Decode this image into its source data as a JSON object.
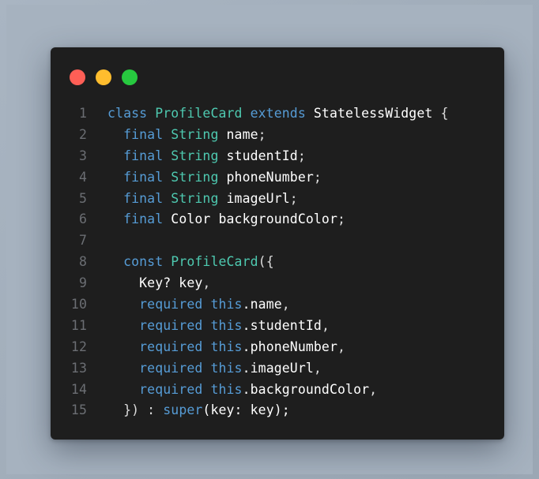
{
  "colors": {
    "background": "#a6b2bf",
    "editor_background": "#1e1e1e",
    "close_dot": "#ff5f56",
    "minimize_dot": "#ffbd2e",
    "maximize_dot": "#27c93f",
    "keyword": "#569cd6",
    "type": "#4ec9b0",
    "identifier": "#ffffff",
    "line_number": "#6b6e73"
  },
  "window_controls": [
    {
      "name": "close-button",
      "color": "#ff5f56"
    },
    {
      "name": "minimize-button",
      "color": "#ffbd2e"
    },
    {
      "name": "maximize-button",
      "color": "#27c93f"
    }
  ],
  "code": {
    "lines": [
      {
        "number": "1",
        "tokens": [
          {
            "t": "class ",
            "c": "kw2"
          },
          {
            "t": "ProfileCard",
            "c": "type"
          },
          {
            "t": " extends ",
            "c": "kw2"
          },
          {
            "t": "StatelessWidget",
            "c": "id"
          },
          {
            "t": " {",
            "c": "punc"
          }
        ]
      },
      {
        "number": "2",
        "tokens": [
          {
            "t": "  final ",
            "c": "kw2"
          },
          {
            "t": "String",
            "c": "type"
          },
          {
            "t": " name",
            "c": "id"
          },
          {
            "t": ";",
            "c": "punc"
          }
        ]
      },
      {
        "number": "3",
        "tokens": [
          {
            "t": "  final ",
            "c": "kw2"
          },
          {
            "t": "String",
            "c": "type"
          },
          {
            "t": " studentId",
            "c": "id"
          },
          {
            "t": ";",
            "c": "punc"
          }
        ]
      },
      {
        "number": "4",
        "tokens": [
          {
            "t": "  final ",
            "c": "kw2"
          },
          {
            "t": "String",
            "c": "type"
          },
          {
            "t": " phoneNumber",
            "c": "id"
          },
          {
            "t": ";",
            "c": "punc"
          }
        ]
      },
      {
        "number": "5",
        "tokens": [
          {
            "t": "  final ",
            "c": "kw2"
          },
          {
            "t": "String",
            "c": "type"
          },
          {
            "t": " imageUrl",
            "c": "id"
          },
          {
            "t": ";",
            "c": "punc"
          }
        ]
      },
      {
        "number": "6",
        "tokens": [
          {
            "t": "  final ",
            "c": "kw2"
          },
          {
            "t": "Color",
            "c": "id"
          },
          {
            "t": " backgroundColor",
            "c": "id"
          },
          {
            "t": ";",
            "c": "punc"
          }
        ]
      },
      {
        "number": "7",
        "tokens": []
      },
      {
        "number": "8",
        "tokens": [
          {
            "t": "  const ",
            "c": "kw2"
          },
          {
            "t": "ProfileCard",
            "c": "type"
          },
          {
            "t": "({",
            "c": "punc"
          }
        ]
      },
      {
        "number": "9",
        "tokens": [
          {
            "t": "    Key? key",
            "c": "id"
          },
          {
            "t": ",",
            "c": "punc"
          }
        ]
      },
      {
        "number": "10",
        "tokens": [
          {
            "t": "    required ",
            "c": "kw2"
          },
          {
            "t": "this",
            "c": "kw2"
          },
          {
            "t": ".name",
            "c": "id"
          },
          {
            "t": ",",
            "c": "punc"
          }
        ]
      },
      {
        "number": "11",
        "tokens": [
          {
            "t": "    required ",
            "c": "kw2"
          },
          {
            "t": "this",
            "c": "kw2"
          },
          {
            "t": ".studentId",
            "c": "id"
          },
          {
            "t": ",",
            "c": "punc"
          }
        ]
      },
      {
        "number": "12",
        "tokens": [
          {
            "t": "    required ",
            "c": "kw2"
          },
          {
            "t": "this",
            "c": "kw2"
          },
          {
            "t": ".phoneNumber",
            "c": "id"
          },
          {
            "t": ",",
            "c": "punc"
          }
        ]
      },
      {
        "number": "13",
        "tokens": [
          {
            "t": "    required ",
            "c": "kw2"
          },
          {
            "t": "this",
            "c": "kw2"
          },
          {
            "t": ".imageUrl",
            "c": "id"
          },
          {
            "t": ",",
            "c": "punc"
          }
        ]
      },
      {
        "number": "14",
        "tokens": [
          {
            "t": "    required ",
            "c": "kw2"
          },
          {
            "t": "this",
            "c": "kw2"
          },
          {
            "t": ".backgroundColor",
            "c": "id"
          },
          {
            "t": ",",
            "c": "punc"
          }
        ]
      },
      {
        "number": "15",
        "tokens": [
          {
            "t": "  }) : ",
            "c": "punc"
          },
          {
            "t": "super",
            "c": "kw2"
          },
          {
            "t": "(key: key);",
            "c": "id"
          }
        ]
      }
    ]
  }
}
